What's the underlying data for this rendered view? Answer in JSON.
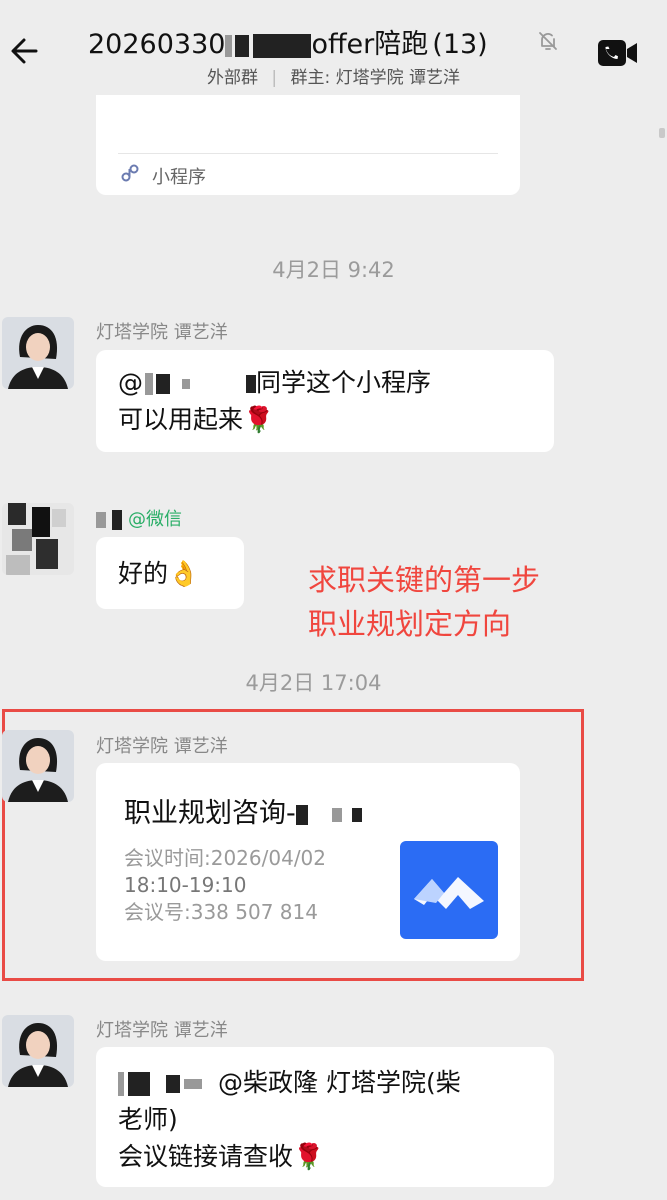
{
  "header": {
    "title": "20260330",
    "title_suffix": "offer陪跑",
    "member_count": "(13)",
    "subtitle_tag": "外部群",
    "subtitle_separator": "|",
    "subtitle_owner": "群主: 灯塔学院 谭艺洋"
  },
  "mini_program_card": {
    "label": "小程序"
  },
  "messages": {
    "ts1": "4月2日  9:42",
    "m1": {
      "sender": "灯塔学院  谭艺洋",
      "line1_prefix": "@",
      "line1_suffix": "同学这个小程序",
      "line2": "可以用起来",
      "emoji": "🌹"
    },
    "m2": {
      "tag": "@微信",
      "text": "好的",
      "emoji": "👌"
    },
    "annotation": {
      "line1": "求职关键的第一步",
      "line2": "职业规划定方向",
      "color": "#f0463e"
    },
    "ts2": "4月2日  17:04",
    "m3": {
      "sender": "灯塔学院  谭艺洋",
      "meeting_title": "职业规划咨询-",
      "time_line": "会议时间:2026/04/02",
      "time_range": "18:10-19:10",
      "meeting_id": "会议号:338 507 814"
    },
    "m4": {
      "sender": "灯塔学院  谭艺洋",
      "line1": "@柴政隆 灯塔学院(柴",
      "line2": "老师)",
      "line3": "会议链接请查收",
      "emoji": "🌹"
    }
  },
  "colors": {
    "background": "#ededed",
    "bubble": "#ffffff",
    "highlight": "#e94b45",
    "wechat_tag": "#2aae67",
    "meeting_logo": "#2b6cf4"
  },
  "icons": [
    "back-arrow-icon",
    "mute-bell-icon",
    "video-call-icon",
    "mini-program-icon",
    "tencent-meeting-logo-icon"
  ]
}
